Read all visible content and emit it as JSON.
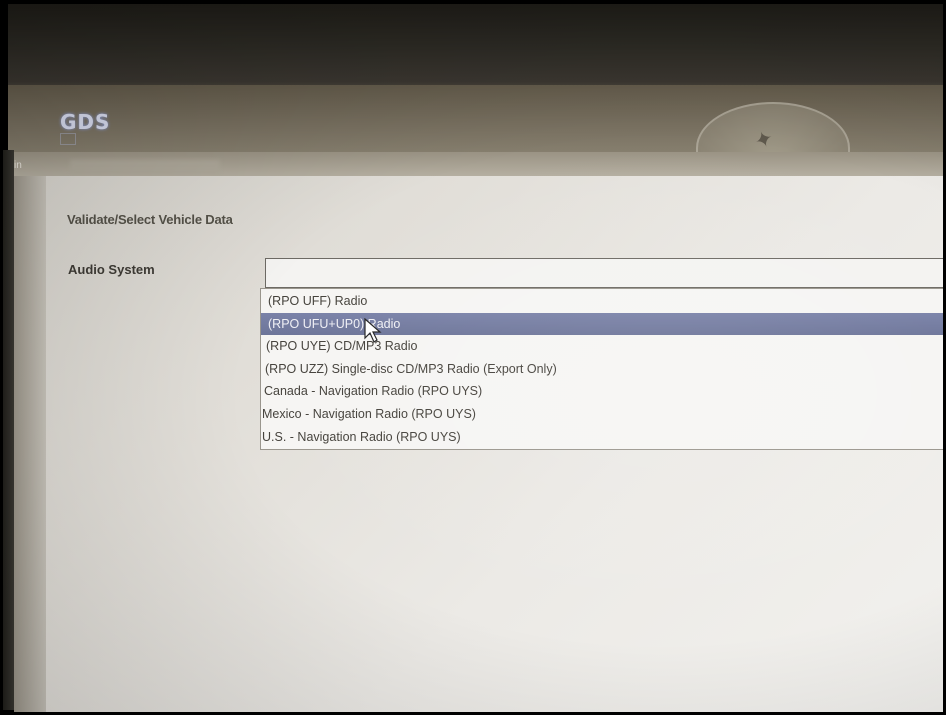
{
  "app": {
    "logo": "GDS",
    "tab_partial_label": "in"
  },
  "page": {
    "title": "Validate/Select Vehicle Data"
  },
  "audio_system": {
    "label": "Audio System",
    "selected_value": "",
    "options": [
      "(RPO UFF) Radio",
      "(RPO UFU+UP0) Radio",
      "(RPO UYE) CD/MP3 Radio",
      "(RPO UZZ) Single-disc CD/MP3 Radio (Export Only)",
      "Canada - Navigation Radio (RPO UYS)",
      "Mexico - Navigation Radio (RPO UYS)",
      "U.S. - Navigation Radio (RPO UYS)"
    ],
    "highlighted_index": 1
  },
  "colors": {
    "highlight": "#737ba0",
    "panel_bg": "#e6e3de",
    "text": "#45423c"
  },
  "icons": {
    "logo": "gds-logo",
    "globe": "globe-emblem-icon",
    "cursor": "mouse-pointer-icon"
  }
}
